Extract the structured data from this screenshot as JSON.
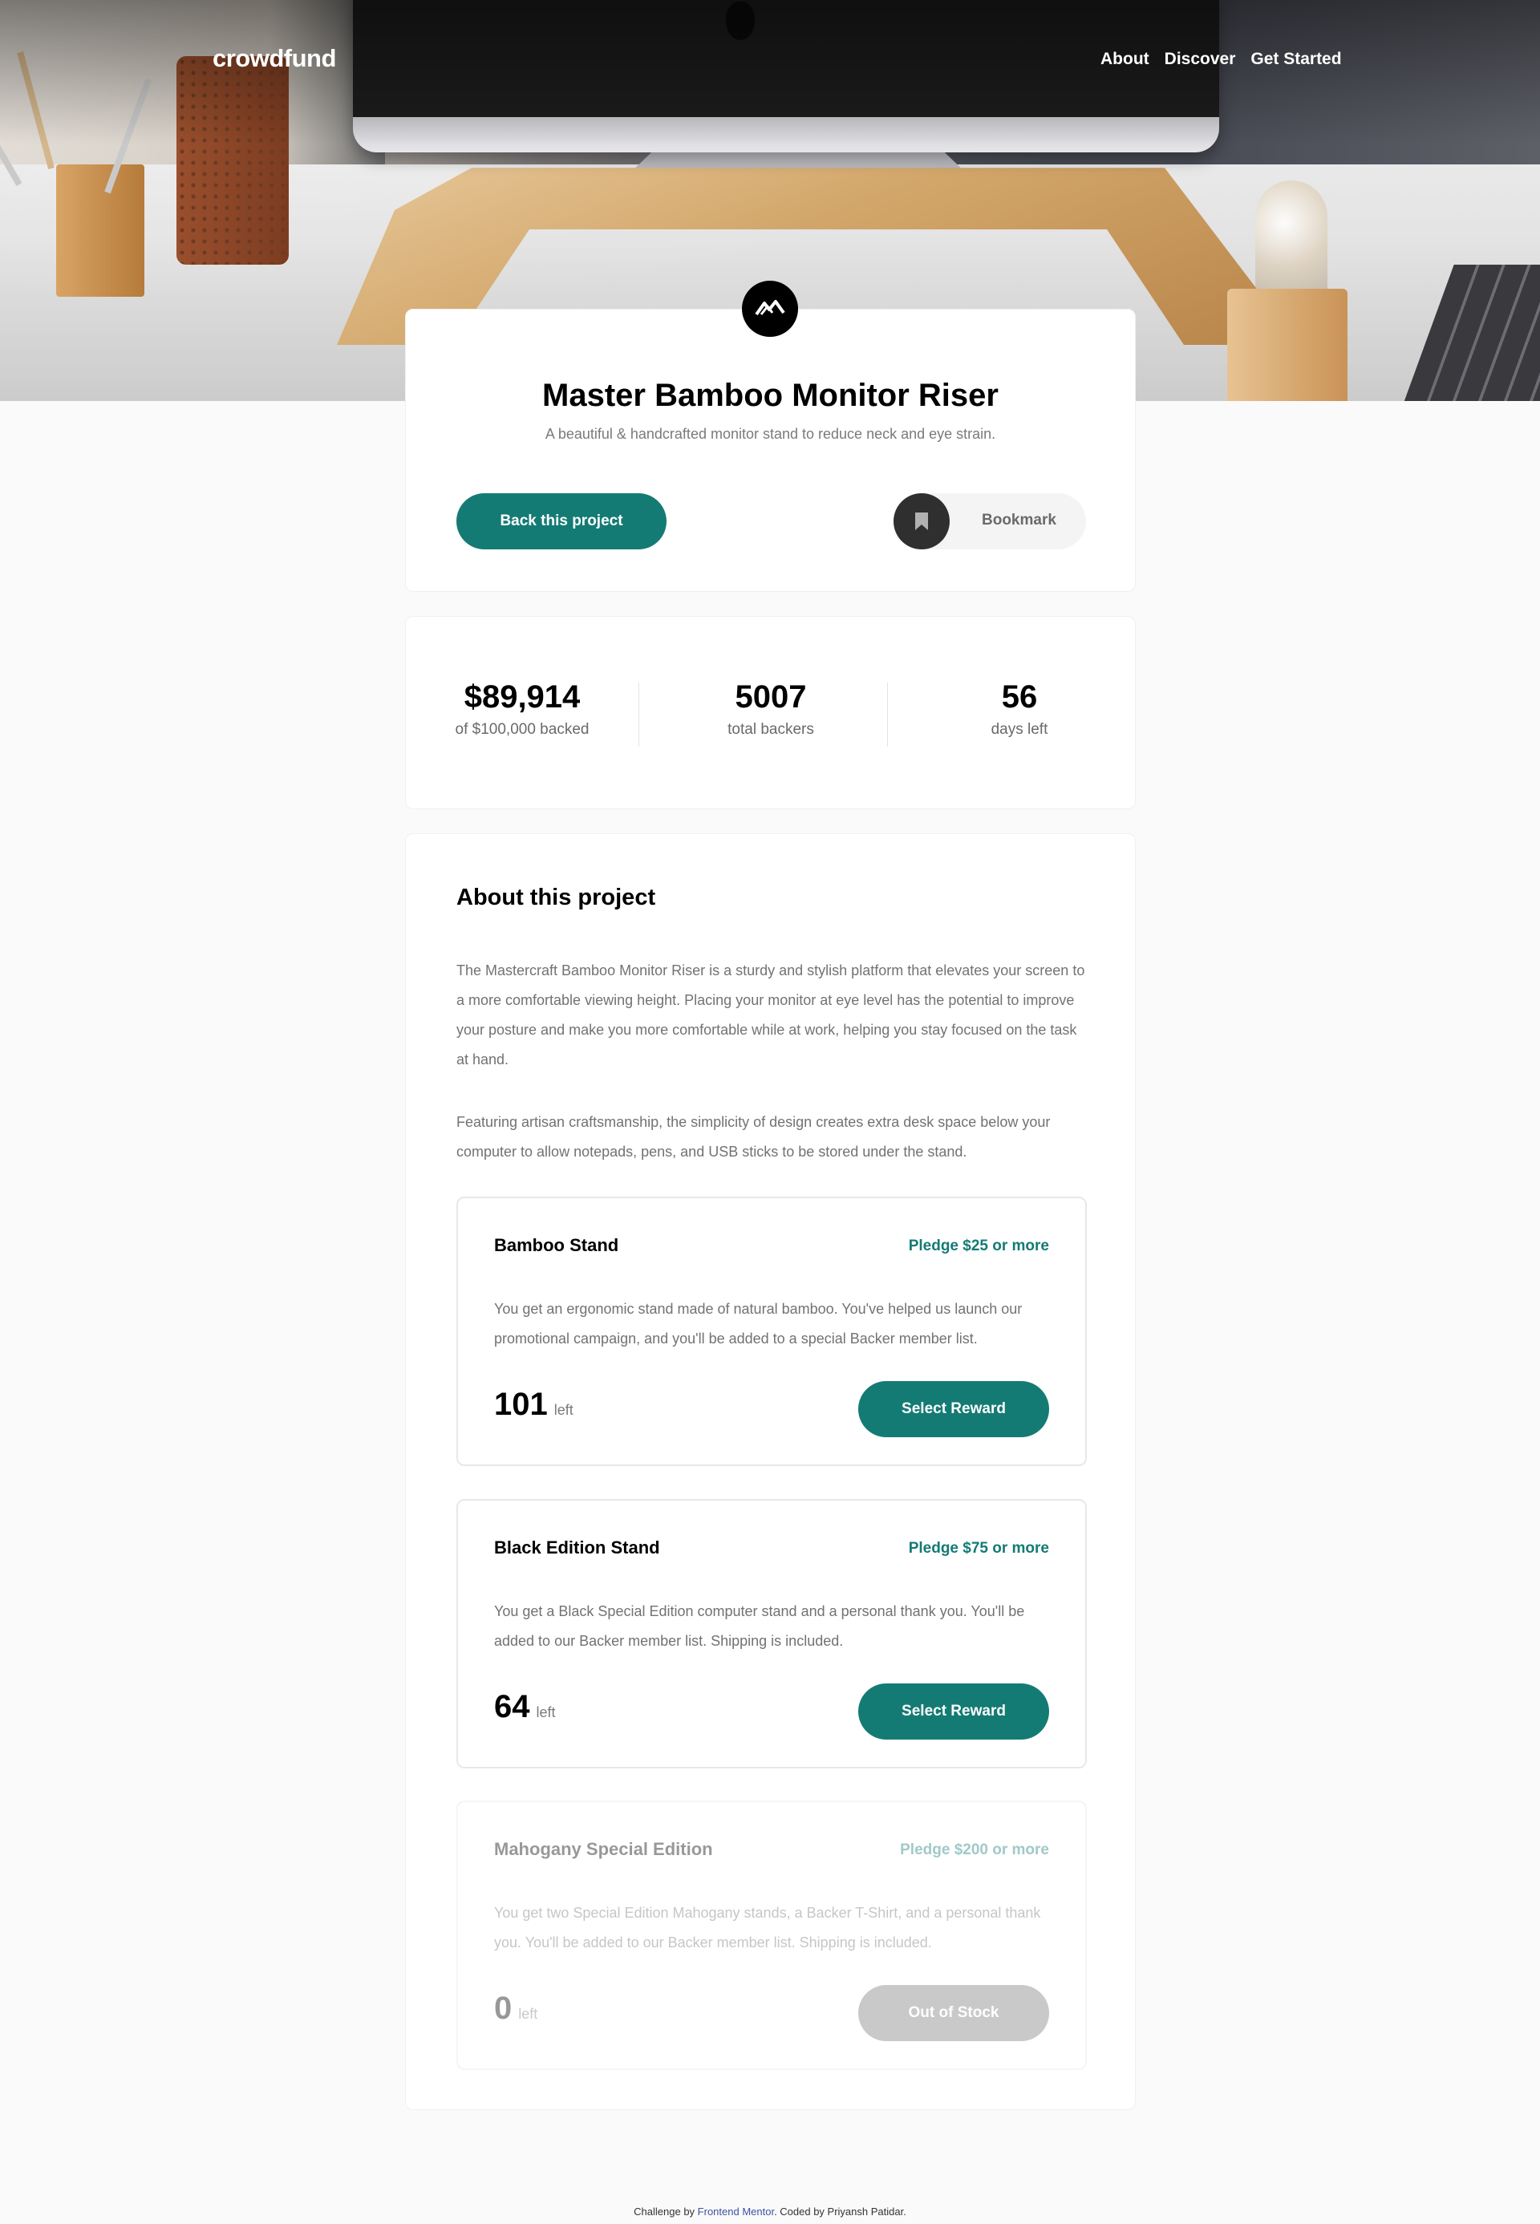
{
  "nav": {
    "logo": "crowdfund",
    "links": [
      "About",
      "Discover",
      "Get Started"
    ]
  },
  "hero": {
    "title": "Master Bamboo Monitor Riser",
    "subtitle": "A beautiful & handcrafted monitor stand to reduce neck and eye strain.",
    "back_button": "Back this project",
    "bookmark_label": "Bookmark"
  },
  "stats": [
    {
      "value": "$89,914",
      "label": "of $100,000 backed"
    },
    {
      "value": "5007",
      "label": "total backers"
    },
    {
      "value": "56",
      "label": "days left"
    }
  ],
  "about": {
    "title": "About this project",
    "paragraphs": [
      "The Mastercraft Bamboo Monitor Riser is a sturdy and stylish platform that elevates your screen to a more comfortable viewing height. Placing your monitor at eye level has the potential to improve your posture and make you more comfortable while at work, helping you stay focused on the task at hand.",
      "Featuring artisan craftsmanship, the simplicity of design creates extra desk space below your computer to allow notepads, pens, and USB sticks to be stored under the stand."
    ]
  },
  "rewards": [
    {
      "name": "Bamboo Stand",
      "pledge": "Pledge $25 or more",
      "description": "You get an ergonomic stand made of natural bamboo. You've helped us launch our promotional campaign, and you'll be added to a special Backer member list.",
      "left_count": "101",
      "left_label": "left",
      "button": "Select Reward"
    },
    {
      "name": "Black Edition Stand",
      "pledge": "Pledge $75 or more",
      "description": "You get a Black Special Edition computer stand and a personal thank you. You'll be added to our Backer member list. Shipping is included.",
      "left_count": "64",
      "left_label": "left",
      "button": "Select Reward"
    },
    {
      "name": "Mahogany Special Edition",
      "pledge": "Pledge $200 or more",
      "description": "You get two Special Edition Mahogany stands, a Backer T-Shirt, and a personal thank you. You'll be added to our Backer member list. Shipping is included.",
      "left_count": "0",
      "left_label": "left",
      "button": "Out of Stock"
    }
  ],
  "footer": {
    "prefix": "Challenge by",
    "link": "Frontend Mentor",
    "suffix": ". Coded by Priyansh Patidar."
  },
  "colors": {
    "accent": "#147b74",
    "accent_light": "#3cb3ab",
    "dark": "#2f2f2f",
    "disabled": "#7a7a7a"
  }
}
